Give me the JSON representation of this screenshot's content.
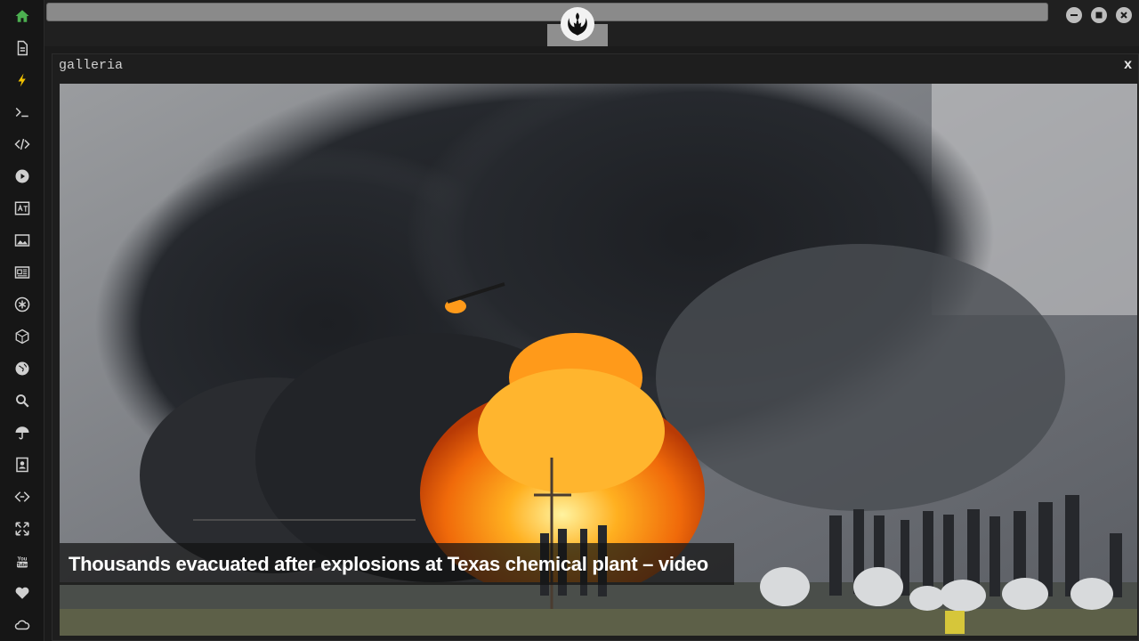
{
  "window": {
    "title": "galleria",
    "close_label": "x"
  },
  "gallery": {
    "caption": "Thousands evacuated after explosions at Texas chemical plant – video"
  },
  "sidebar": {
    "items": [
      {
        "icon": "home-icon",
        "color": "#4caf50"
      },
      {
        "icon": "document-icon"
      },
      {
        "icon": "lightning-icon",
        "color": "#f2c200"
      },
      {
        "icon": "terminal-icon"
      },
      {
        "icon": "code-icon"
      },
      {
        "icon": "play-icon"
      },
      {
        "icon": "translate-icon"
      },
      {
        "icon": "image-icon"
      },
      {
        "icon": "news-icon"
      },
      {
        "icon": "asterisk-icon"
      },
      {
        "icon": "cube-icon"
      },
      {
        "icon": "globe-icon"
      },
      {
        "icon": "search-icon"
      },
      {
        "icon": "umbrella-icon"
      },
      {
        "icon": "contact-icon"
      },
      {
        "icon": "api-icon"
      },
      {
        "icon": "expand-icon"
      },
      {
        "icon": "youtube-icon"
      },
      {
        "icon": "heart-icon"
      },
      {
        "icon": "cloud-icon"
      }
    ]
  },
  "window_controls": [
    "minimize-icon",
    "maximize-icon",
    "close-icon"
  ],
  "colors": {
    "accent_green": "#4caf50",
    "accent_yellow": "#f2c200"
  }
}
